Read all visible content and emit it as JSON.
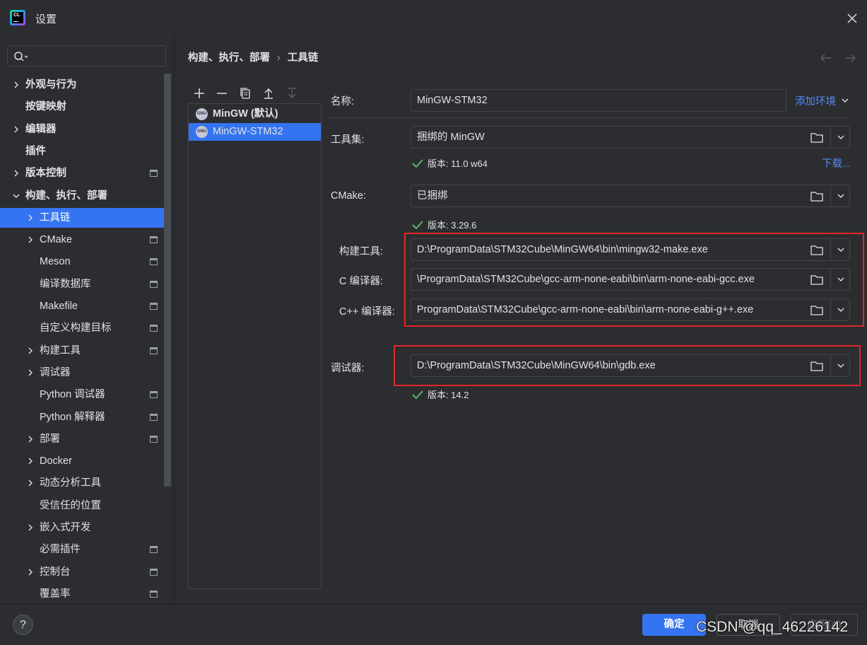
{
  "window": {
    "title": "设置"
  },
  "search": {
    "placeholder": ""
  },
  "sidebar": {
    "items": [
      {
        "label": "外观与行为",
        "level": 0,
        "expand": "collapsed",
        "bold": true,
        "project_icon": false
      },
      {
        "label": "按键映射",
        "level": 0,
        "expand": "none",
        "bold": true,
        "project_icon": false
      },
      {
        "label": "编辑器",
        "level": 0,
        "expand": "collapsed",
        "bold": true,
        "project_icon": false
      },
      {
        "label": "插件",
        "level": 0,
        "expand": "none",
        "bold": true,
        "project_icon": false
      },
      {
        "label": "版本控制",
        "level": 0,
        "expand": "collapsed",
        "bold": true,
        "project_icon": true
      },
      {
        "label": "构建、执行、部署",
        "level": 0,
        "expand": "expanded",
        "bold": true,
        "project_icon": false
      },
      {
        "label": "工具链",
        "level": 1,
        "expand": "collapsed",
        "bold": false,
        "project_icon": false,
        "selected": true
      },
      {
        "label": "CMake",
        "level": 1,
        "expand": "collapsed",
        "bold": false,
        "project_icon": true
      },
      {
        "label": "Meson",
        "level": 1,
        "expand": "none",
        "bold": false,
        "project_icon": true
      },
      {
        "label": "编译数据库",
        "level": 1,
        "expand": "none",
        "bold": false,
        "project_icon": true
      },
      {
        "label": "Makefile",
        "level": 1,
        "expand": "none",
        "bold": false,
        "project_icon": true
      },
      {
        "label": "自定义构建目标",
        "level": 1,
        "expand": "none",
        "bold": false,
        "project_icon": true
      },
      {
        "label": "构建工具",
        "level": 1,
        "expand": "collapsed",
        "bold": false,
        "project_icon": true
      },
      {
        "label": "调试器",
        "level": 1,
        "expand": "collapsed",
        "bold": false,
        "project_icon": false
      },
      {
        "label": "Python 调试器",
        "level": 1,
        "expand": "none",
        "bold": false,
        "project_icon": true
      },
      {
        "label": "Python 解释器",
        "level": 1,
        "expand": "none",
        "bold": false,
        "project_icon": true
      },
      {
        "label": "部署",
        "level": 1,
        "expand": "collapsed",
        "bold": false,
        "project_icon": true
      },
      {
        "label": "Docker",
        "level": 1,
        "expand": "collapsed",
        "bold": false,
        "project_icon": false
      },
      {
        "label": "动态分析工具",
        "level": 1,
        "expand": "collapsed",
        "bold": false,
        "project_icon": false
      },
      {
        "label": "受信任的位置",
        "level": 1,
        "expand": "none",
        "bold": false,
        "project_icon": false
      },
      {
        "label": "嵌入式开发",
        "level": 1,
        "expand": "collapsed",
        "bold": false,
        "project_icon": false
      },
      {
        "label": "必需插件",
        "level": 1,
        "expand": "none",
        "bold": false,
        "project_icon": true
      },
      {
        "label": "控制台",
        "level": 1,
        "expand": "collapsed",
        "bold": false,
        "project_icon": true
      },
      {
        "label": "覆盖率",
        "level": 1,
        "expand": "none",
        "bold": false,
        "project_icon": true
      }
    ]
  },
  "breadcrumb": {
    "parent": "构建、执行、部署",
    "separator": "›",
    "current": "工具链"
  },
  "toolchains": {
    "items": [
      {
        "label": "MinGW (默认)",
        "icon": "GNU",
        "bold": true
      },
      {
        "label": "MinGW-STM32",
        "icon": "GNU",
        "bold": false,
        "selected": true
      }
    ]
  },
  "form": {
    "name_label": "名称:",
    "name_value": "MinGW-STM32",
    "add_env_label": "添加环境",
    "toolset_label": "工具集:",
    "toolset_value": "捆绑的 MinGW",
    "toolset_version": "版本: 11.0 w64",
    "download_label": "下载...",
    "cmake_label": "CMake:",
    "cmake_value": "已捆绑",
    "cmake_version": "版本: 3.29.6",
    "build_tool_label": "构建工具:",
    "build_tool_value": "D:\\ProgramData\\STM32Cube\\MinGW64\\bin\\mingw32-make.exe",
    "c_compiler_label": "C 编译器:",
    "c_compiler_value": "\\ProgramData\\STM32Cube\\gcc-arm-none-eabi\\bin\\arm-none-eabi-gcc.exe",
    "cpp_compiler_label": "C++ 编译器:",
    "cpp_compiler_value": "ProgramData\\STM32Cube\\gcc-arm-none-eabi\\bin\\arm-none-eabi-g++.exe",
    "debugger_label": "调试器:",
    "debugger_value": "D:\\ProgramData\\STM32Cube\\MinGW64\\bin\\gdb.exe",
    "debugger_version": "版本: 14.2"
  },
  "footer": {
    "help_label": "?",
    "ok_label": "确定",
    "cancel_label": "取消",
    "apply_label": "应用(A)"
  },
  "watermark": "CSDN @qq_46226142",
  "colors": {
    "accent": "#3574f0",
    "link": "#548af7",
    "check": "#5fb865",
    "highlight_box": "#e3252a",
    "background": "#2b2d30"
  }
}
